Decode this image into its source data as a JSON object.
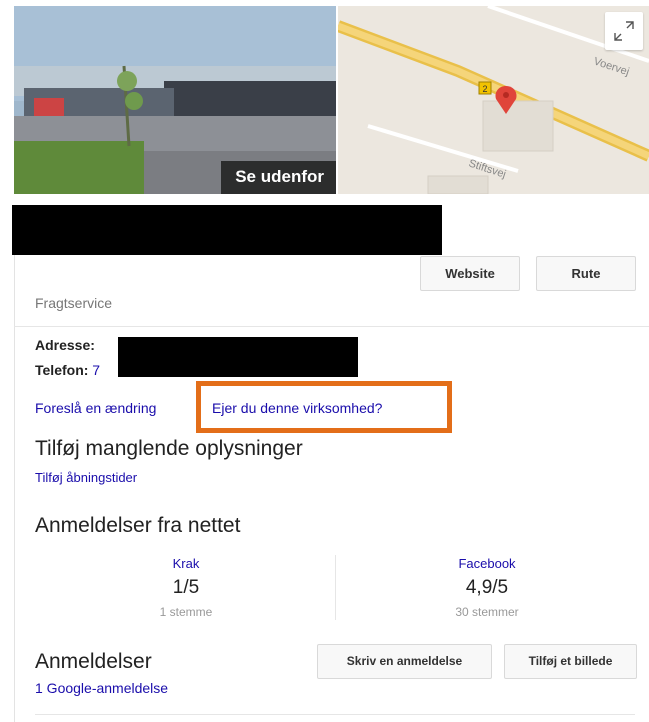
{
  "streetview": {
    "button_label": "Se udenfor"
  },
  "map": {
    "road_labels": [
      "Voervej",
      "Stiftsvej"
    ],
    "route_number": "2",
    "expand_icon": "expand-icon",
    "pin_icon": "map-pin-icon",
    "pin_color": "#e0443a",
    "road_color": "#f5c84c"
  },
  "actions": {
    "website": "Website",
    "route": "Rute"
  },
  "category": "Fragtservice",
  "info": {
    "address_label": "Adresse:",
    "phone_label": "Telefon:",
    "phone_prefix": "7"
  },
  "links": {
    "suggest_edit": "Foreslå en ændring",
    "own_business": "Ejer du denne virksomhed?"
  },
  "missing_info": {
    "heading": "Tilføj manglende oplysninger",
    "add_hours": "Tilføj åbningstider"
  },
  "web_reviews": {
    "heading": "Anmeldelser fra nettet",
    "sources": [
      {
        "name": "Krak",
        "score": "1/5",
        "votes": "1 stemme"
      },
      {
        "name": "Facebook",
        "score": "4,9/5",
        "votes": "30 stemmer"
      }
    ]
  },
  "reviews": {
    "heading": "Anmeldelser",
    "write_review": "Skriv en anmeldelse",
    "add_photo": "Tilføj et billede",
    "google_count": "1 Google-anmeldelse"
  },
  "highlight_color": "#e36e19"
}
